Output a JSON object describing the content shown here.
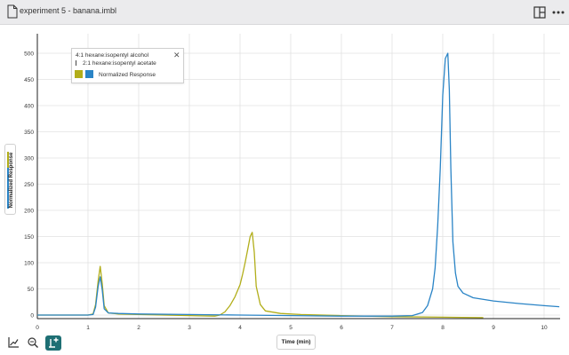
{
  "window": {
    "file_name": "experiment 5 - banana.imbl",
    "icons": {
      "document": "document-icon",
      "layout": "split-view-icon",
      "more": "more-icon"
    }
  },
  "legend": {
    "row1": "4:1 hexane:isopentyl alcohol",
    "row2": "2:1 hexane:isopentyl acetate",
    "row3": "Normalized Response",
    "close_glyph": "✕",
    "colors": {
      "yellow": "#b2ae1a",
      "blue": "#2a84c6"
    }
  },
  "axis_labels": {
    "y": "Normalized Response",
    "x": "Time (min)"
  },
  "toolbar": {
    "buttons": [
      {
        "icon": "line-chart-icon",
        "active": false
      },
      {
        "icon": "zoom-icon",
        "active": false
      },
      {
        "icon": "add-marker-icon",
        "active": true
      }
    ]
  },
  "chart_data": {
    "type": "line",
    "xlabel": "Time (min)",
    "ylabel": "Normalized Response",
    "xlim": [
      0,
      10.3
    ],
    "ylim": [
      -5,
      540
    ],
    "xticks": [
      "0",
      "1",
      "2",
      "3",
      "4",
      "5",
      "6",
      "7",
      "8",
      "9",
      "10"
    ],
    "yticks": [
      "0",
      "50",
      "100",
      "150",
      "200",
      "250",
      "300",
      "350",
      "400",
      "450",
      "500"
    ],
    "grid": true,
    "legend_position": "top-left",
    "series": [
      {
        "color": "#b2ae1a",
        "x": [
          0,
          1.0,
          1.1,
          1.15,
          1.2,
          1.24,
          1.28,
          1.32,
          1.4,
          1.6,
          2.0,
          3.0,
          3.5,
          3.6,
          3.7,
          3.8,
          3.9,
          4.0,
          4.05,
          4.1,
          4.15,
          4.2,
          4.24,
          4.28,
          4.32,
          4.4,
          4.5,
          4.8,
          5.2,
          6.0,
          7.0,
          8.0,
          8.8
        ],
        "y": [
          0,
          0,
          2,
          20,
          65,
          93,
          60,
          18,
          4,
          2,
          1,
          -1,
          -2,
          0,
          6,
          18,
          35,
          58,
          78,
          100,
          125,
          150,
          158,
          120,
          55,
          20,
          8,
          3,
          1,
          -1,
          -3,
          -4,
          -5
        ]
      },
      {
        "color": "#2a84c6",
        "x": [
          0,
          1.0,
          1.1,
          1.15,
          1.2,
          1.24,
          1.28,
          1.32,
          1.4,
          1.6,
          2.0,
          3.0,
          4.0,
          5.0,
          6.0,
          7.0,
          7.4,
          7.6,
          7.7,
          7.8,
          7.85,
          7.9,
          7.95,
          8.0,
          8.05,
          8.1,
          8.13,
          8.16,
          8.2,
          8.25,
          8.3,
          8.4,
          8.6,
          9.0,
          9.5,
          10.0,
          10.3
        ],
        "y": [
          0,
          0,
          1,
          15,
          55,
          73,
          48,
          12,
          4,
          3,
          2,
          1,
          0,
          -1,
          -2,
          -2,
          -1,
          5,
          18,
          50,
          90,
          170,
          280,
          420,
          490,
          500,
          430,
          280,
          140,
          80,
          55,
          42,
          33,
          27,
          22,
          18,
          16
        ]
      }
    ]
  }
}
